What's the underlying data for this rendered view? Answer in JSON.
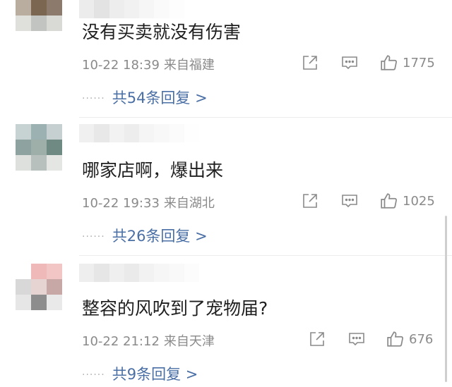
{
  "comments": [
    {
      "text": "没有买卖就没有伤害",
      "date": "10-22 18:39",
      "location": "来自福建",
      "likes": "1775",
      "replies_dots": "······",
      "replies_label": "共54条回复 >"
    },
    {
      "text": "哪家店啊，爆出来",
      "date": "10-22 19:33",
      "location": "来自湖北",
      "likes": "1025",
      "replies_dots": "······",
      "replies_label": "共26条回复 >"
    },
    {
      "text": "整容的风吹到了宠物届?",
      "date": "10-22 21:12",
      "location": "来自天津",
      "likes": "676",
      "replies_dots": "······",
      "replies_label": "共9条回复 >"
    }
  ],
  "icons": {
    "share": "share-icon",
    "comment": "comment-icon",
    "like": "thumbs-up-icon"
  },
  "colors": {
    "reply_link": "#4a6fa5",
    "meta": "#8a8a8a"
  }
}
